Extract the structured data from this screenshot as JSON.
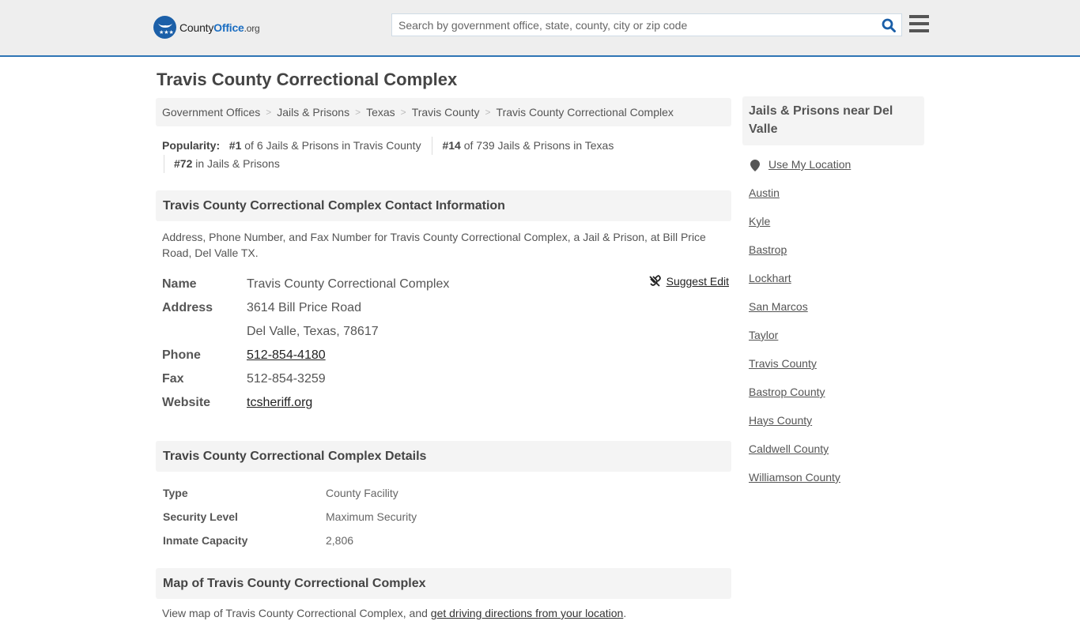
{
  "header": {
    "logo": {
      "brand_prefix": "County",
      "brand_accent": "Office",
      "brand_suffix": ".org",
      "icon": "eagle-stars-icon"
    },
    "search": {
      "placeholder": "Search by government office, state, county, city or zip code",
      "value": "",
      "icon": "search-icon"
    },
    "menu_icon": "hamburger-menu-icon"
  },
  "page": {
    "title": "Travis County Correctional Complex"
  },
  "breadcrumb": [
    {
      "label": "Government Offices"
    },
    {
      "label": "Jails & Prisons"
    },
    {
      "label": "Texas"
    },
    {
      "label": "Travis County"
    },
    {
      "label": "Travis County Correctional Complex"
    }
  ],
  "breadcrumb_separator": ">",
  "popularity": {
    "label": "Popularity:",
    "items": [
      {
        "rank": "#1",
        "text": "of 6 Jails & Prisons in Travis County"
      },
      {
        "rank": "#14",
        "text": "of 739 Jails & Prisons in Texas"
      },
      {
        "rank": "#72",
        "text": "in Jails & Prisons"
      }
    ]
  },
  "contact": {
    "heading": "Travis County Correctional Complex Contact Information",
    "description": "Address, Phone Number, and Fax Number for Travis County Correctional Complex, a Jail & Prison, at Bill Price Road, Del Valle TX.",
    "suggest_edit": "Suggest Edit",
    "fields": {
      "name": {
        "label": "Name",
        "value": "Travis County Correctional Complex"
      },
      "address": {
        "label": "Address",
        "line1": "3614 Bill Price Road",
        "line2": "Del Valle, Texas, 78617"
      },
      "phone": {
        "label": "Phone",
        "value": "512-854-4180"
      },
      "fax": {
        "label": "Fax",
        "value": "512-854-3259"
      },
      "website": {
        "label": "Website",
        "value": "tcsheriff.org"
      }
    }
  },
  "details": {
    "heading": "Travis County Correctional Complex Details",
    "rows": [
      {
        "label": "Type",
        "value": "County Facility"
      },
      {
        "label": "Security Level",
        "value": "Maximum Security"
      },
      {
        "label": "Inmate Capacity",
        "value": "2,806"
      }
    ]
  },
  "map": {
    "heading": "Map of Travis County Correctional Complex",
    "text_prefix": "View map of Travis County Correctional Complex, and ",
    "link": "get driving directions from your location",
    "text_suffix": "."
  },
  "sidebar": {
    "heading": "Jails & Prisons near Del Valle",
    "use_location": "Use My Location",
    "links": [
      "Austin",
      "Kyle",
      "Bastrop",
      "Lockhart",
      "San Marcos",
      "Taylor",
      "Travis County",
      "Bastrop County",
      "Hays County",
      "Caldwell County",
      "Williamson County"
    ]
  },
  "colors": {
    "brand_blue": "#1b6ec2",
    "header_border": "#2f75b5",
    "header_bg": "#eeeeee",
    "section_bg": "#f4f4f4"
  }
}
